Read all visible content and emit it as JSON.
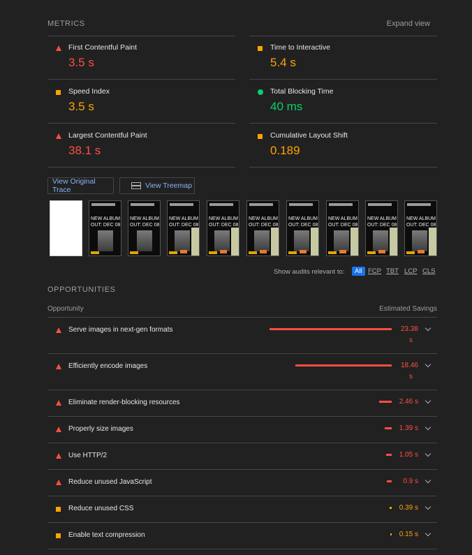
{
  "metrics": {
    "title": "METRICS",
    "expand_label": "Expand view",
    "items": [
      {
        "label": "First Contentful Paint",
        "value": "3.5 s",
        "status": "fail"
      },
      {
        "label": "Time to Interactive",
        "value": "5.4 s",
        "status": "average"
      },
      {
        "label": "Speed Index",
        "value": "3.5 s",
        "status": "average"
      },
      {
        "label": "Total Blocking Time",
        "value": "40 ms",
        "status": "pass"
      },
      {
        "label": "Largest Contentful Paint",
        "value": "38.1 s",
        "status": "fail"
      },
      {
        "label": "Cumulative Layout Shift",
        "value": "0.189",
        "status": "average"
      }
    ]
  },
  "buttons": {
    "view_trace": "View Original Trace",
    "view_treemap": "View Treemap"
  },
  "filmstrip": {
    "frame_text_line1": "NEW ALBUM",
    "frame_text_line2": "OUT: DEC 08"
  },
  "filter": {
    "label": "Show audits relevant to:",
    "options": [
      "All",
      "FCP",
      "TBT",
      "LCP",
      "CLS"
    ],
    "active": "All"
  },
  "opportunities": {
    "title": "OPPORTUNITIES",
    "col_opportunity": "Opportunity",
    "col_savings": "Estimated Savings",
    "items": [
      {
        "title": "Serve images in next-gen formats",
        "saving_line1": "23.38",
        "saving_line2": "s",
        "savings_s": 23.38,
        "status": "fail"
      },
      {
        "title": "Efficiently encode images",
        "saving_line1": "18.46",
        "saving_line2": "s",
        "savings_s": 18.46,
        "status": "fail"
      },
      {
        "title": "Eliminate render-blocking resources",
        "saving_line1": "2.46 s",
        "savings_s": 2.46,
        "status": "fail"
      },
      {
        "title": "Properly size images",
        "saving_line1": "1.39 s",
        "savings_s": 1.39,
        "status": "fail"
      },
      {
        "title": "Use HTTP/2",
        "saving_line1": "1.05 s",
        "savings_s": 1.05,
        "status": "fail"
      },
      {
        "title": "Reduce unused JavaScript",
        "saving_line1": "0.9 s",
        "savings_s": 0.9,
        "status": "fail"
      },
      {
        "title": "Reduce unused CSS",
        "saving_line1": "0.39 s",
        "savings_s": 0.39,
        "status": "average"
      },
      {
        "title": "Enable text compression",
        "saving_line1": "0.15 s",
        "savings_s": 0.15,
        "status": "average"
      }
    ]
  },
  "colors": {
    "fail": "#ff4e42",
    "average": "#ffa400",
    "pass": "#0cce6b"
  }
}
